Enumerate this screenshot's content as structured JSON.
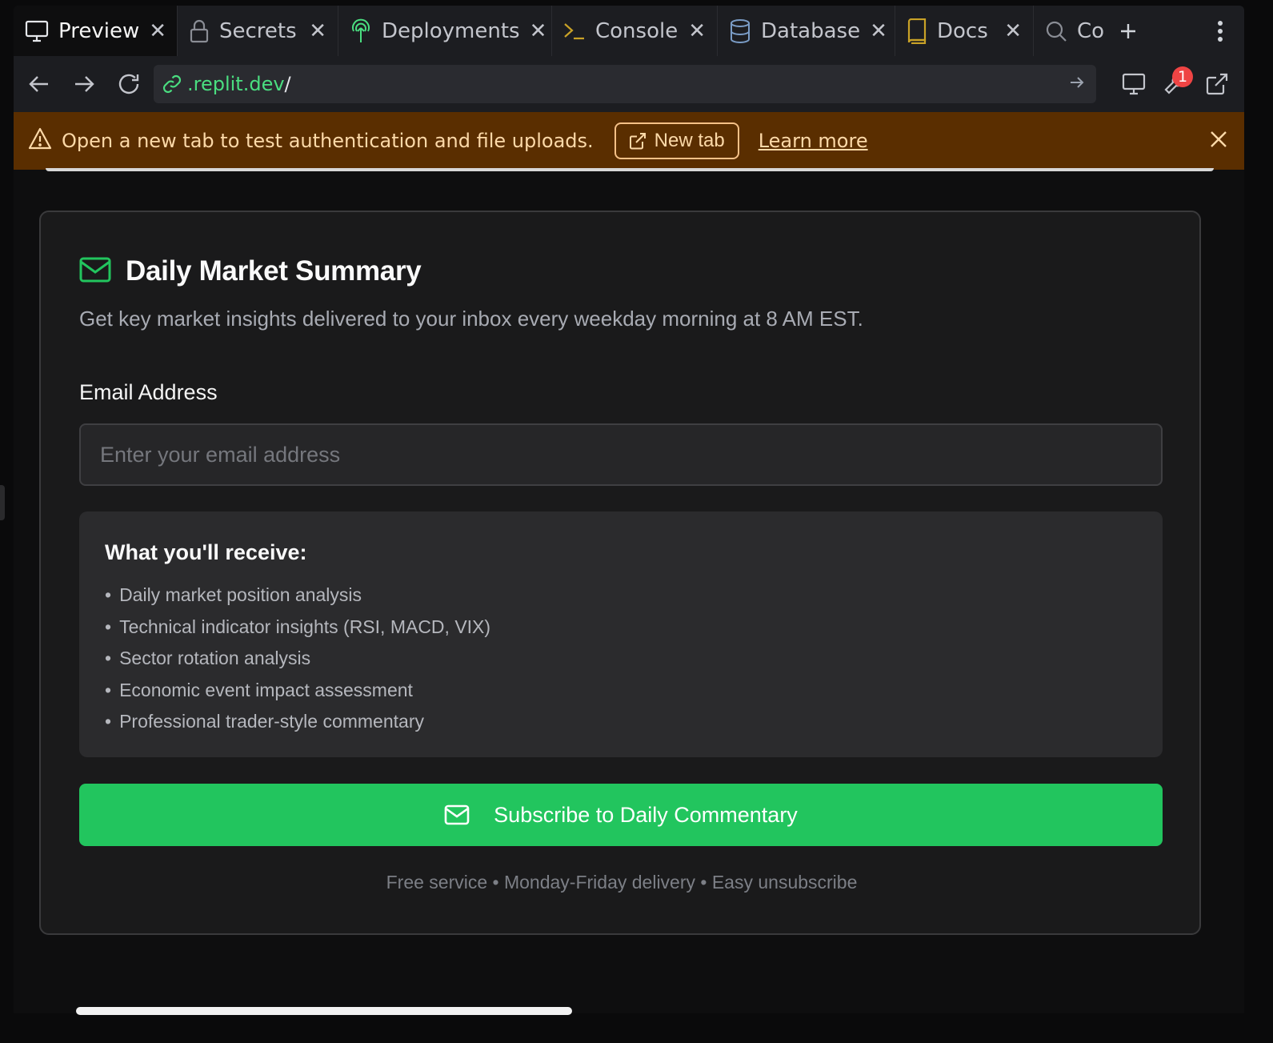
{
  "tabs": [
    {
      "label": "Preview",
      "icon": "monitor-icon",
      "active": true
    },
    {
      "label": "Secrets",
      "icon": "lock-icon"
    },
    {
      "label": "Deployments",
      "icon": "deployments-icon"
    },
    {
      "label": "Console",
      "icon": "terminal-icon"
    },
    {
      "label": "Database",
      "icon": "database-icon"
    },
    {
      "label": "Docs",
      "icon": "book-icon"
    },
    {
      "label": "Co",
      "icon": "search-icon"
    }
  ],
  "address_bar": {
    "url": ".replit.dev",
    "url_suffix": "/",
    "badge_count": "1"
  },
  "banner": {
    "message": "Open a new tab to test authentication and file uploads.",
    "new_tab_label": "New tab",
    "learn_more_label": "Learn more"
  },
  "card": {
    "title": "Daily Market Summary",
    "subtitle": "Get key market insights delivered to your inbox every weekday morning at 8 AM EST.",
    "email_label": "Email Address",
    "email_placeholder": "Enter your email address",
    "email_value": "",
    "receive_title": "What you'll receive:",
    "receive_items": [
      "Daily market position analysis",
      "Technical indicator insights (RSI, MACD, VIX)",
      "Sector rotation analysis",
      "Economic event impact assessment",
      "Professional trader-style commentary"
    ],
    "subscribe_label": "Subscribe to Daily Commentary",
    "footnote": "Free service • Monday-Friday delivery • Easy unsubscribe"
  },
  "colors": {
    "accent_green": "#22c55e",
    "banner_bg": "#5a2e00",
    "url_green": "#4ade80",
    "badge_red": "#ef4444"
  }
}
